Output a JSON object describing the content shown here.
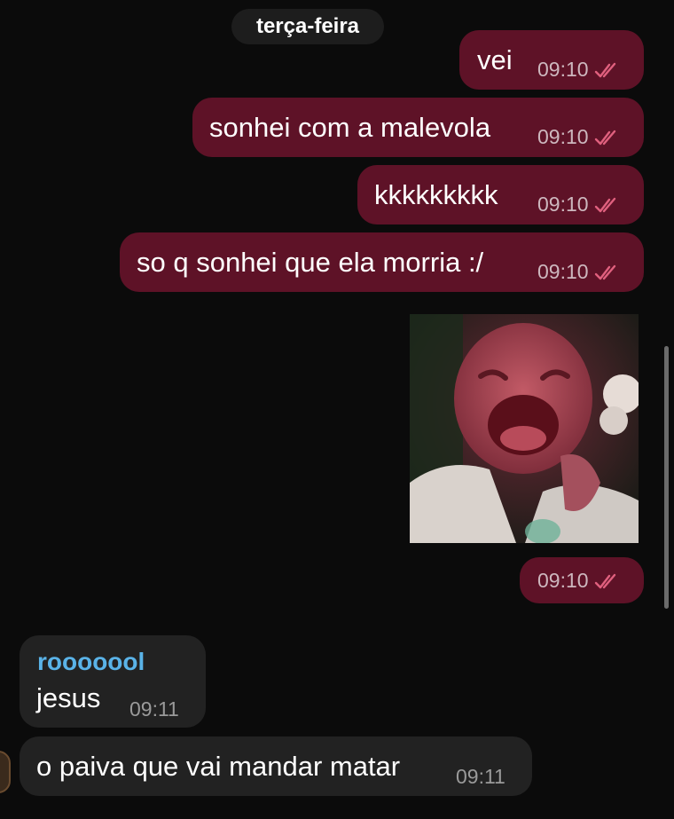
{
  "date_separator": "terça-feira",
  "outgoing": [
    {
      "text": "vei",
      "time": "09:10",
      "status": "read-ticks"
    },
    {
      "text": "sonhei com a malevola",
      "time": "09:10",
      "status": "read-ticks"
    },
    {
      "text": "kkkkkkkkk",
      "time": "09:10",
      "status": "read-ticks"
    },
    {
      "text": "so q sonhei que ela morria :/",
      "time": "09:10",
      "status": "read-ticks"
    }
  ],
  "media_message": {
    "kind": "image",
    "icon": "crying-baby-image",
    "time": "09:10",
    "status": "read-ticks"
  },
  "incoming": [
    {
      "sender": "rooooool",
      "text": "jesus",
      "time": "09:11"
    },
    {
      "text": "o paiva que vai mandar matar",
      "time": "09:11"
    }
  ],
  "colors": {
    "background": "#0b0b0b",
    "outgoing_bubble": "#5e1227",
    "incoming_bubble": "#222222",
    "sender_name": "#5ab3e8",
    "read_ticks": "#e0607e"
  }
}
